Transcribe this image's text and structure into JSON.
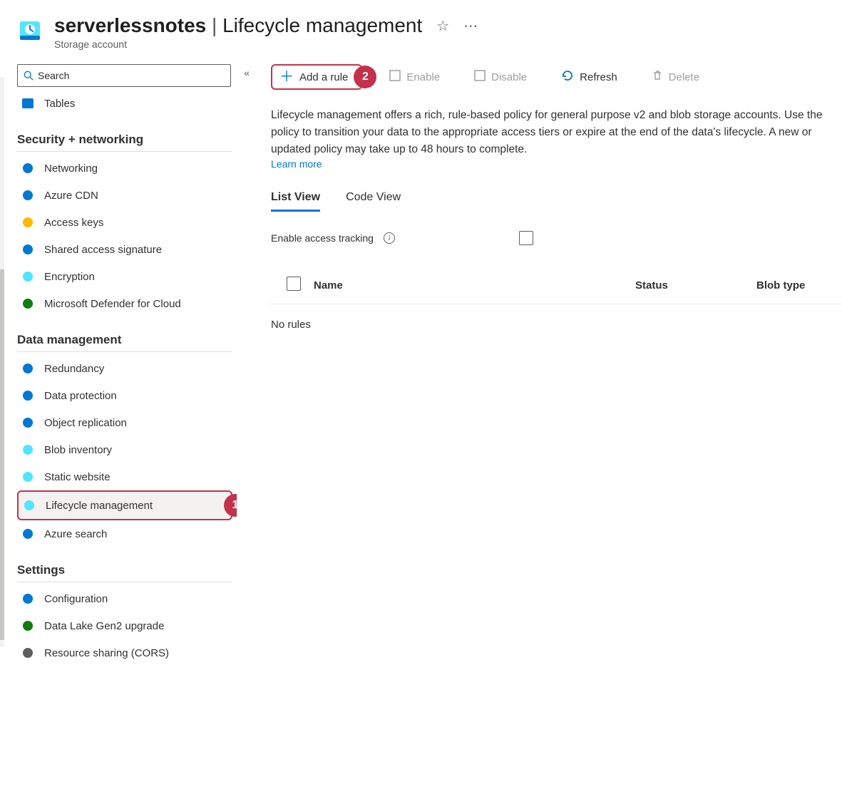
{
  "header": {
    "resource_name": "serverlessnotes",
    "page_title": "Lifecycle management",
    "subtitle": "Storage account"
  },
  "sidebar": {
    "search_placeholder": "Search",
    "top_item": "Tables",
    "groups": [
      {
        "label": "Security + networking",
        "items": [
          {
            "label": "Networking",
            "icon": "globe",
            "color": "#0078d4"
          },
          {
            "label": "Azure CDN",
            "icon": "cloud",
            "color": "#0078d4"
          },
          {
            "label": "Access keys",
            "icon": "key",
            "color": "#ffb900"
          },
          {
            "label": "Shared access signature",
            "icon": "sas",
            "color": "#0078d4"
          },
          {
            "label": "Encryption",
            "icon": "lock",
            "color": "#50e6ff"
          },
          {
            "label": "Microsoft Defender for Cloud",
            "icon": "shield",
            "color": "#107c10"
          }
        ]
      },
      {
        "label": "Data management",
        "items": [
          {
            "label": "Redundancy",
            "icon": "globe2",
            "color": "#0078d4"
          },
          {
            "label": "Data protection",
            "icon": "shield2",
            "color": "#0078d4"
          },
          {
            "label": "Object replication",
            "icon": "replicate",
            "color": "#0078d4"
          },
          {
            "label": "Blob inventory",
            "icon": "inventory",
            "color": "#50e6ff"
          },
          {
            "label": "Static website",
            "icon": "website",
            "color": "#50e6ff"
          },
          {
            "label": "Lifecycle management",
            "icon": "lifecycle",
            "color": "#50e6ff",
            "selected": true,
            "badge": "1"
          },
          {
            "label": "Azure search",
            "icon": "search",
            "color": "#0078d4"
          }
        ]
      },
      {
        "label": "Settings",
        "items": [
          {
            "label": "Configuration",
            "icon": "config",
            "color": "#0078d4"
          },
          {
            "label": "Data Lake Gen2 upgrade",
            "icon": "upgrade",
            "color": "#107c10"
          },
          {
            "label": "Resource sharing (CORS)",
            "icon": "cors",
            "color": "#605e5c"
          }
        ]
      }
    ]
  },
  "toolbar": {
    "add_rule": "Add a rule",
    "add_rule_badge": "2",
    "enable": "Enable",
    "disable": "Disable",
    "refresh": "Refresh",
    "delete": "Delete"
  },
  "main": {
    "description": "Lifecycle management offers a rich, rule-based policy for general purpose v2 and blob storage accounts. Use the policy to transition your data to the appropriate access tiers or expire at the end of the data's lifecycle. A new or updated policy may take up to 48 hours to complete.",
    "learn_more": "Learn more",
    "tabs": {
      "list": "List View",
      "code": "Code View"
    },
    "tracking_label": "Enable access tracking",
    "columns": {
      "name": "Name",
      "status": "Status",
      "blob": "Blob type"
    },
    "empty": "No rules"
  }
}
